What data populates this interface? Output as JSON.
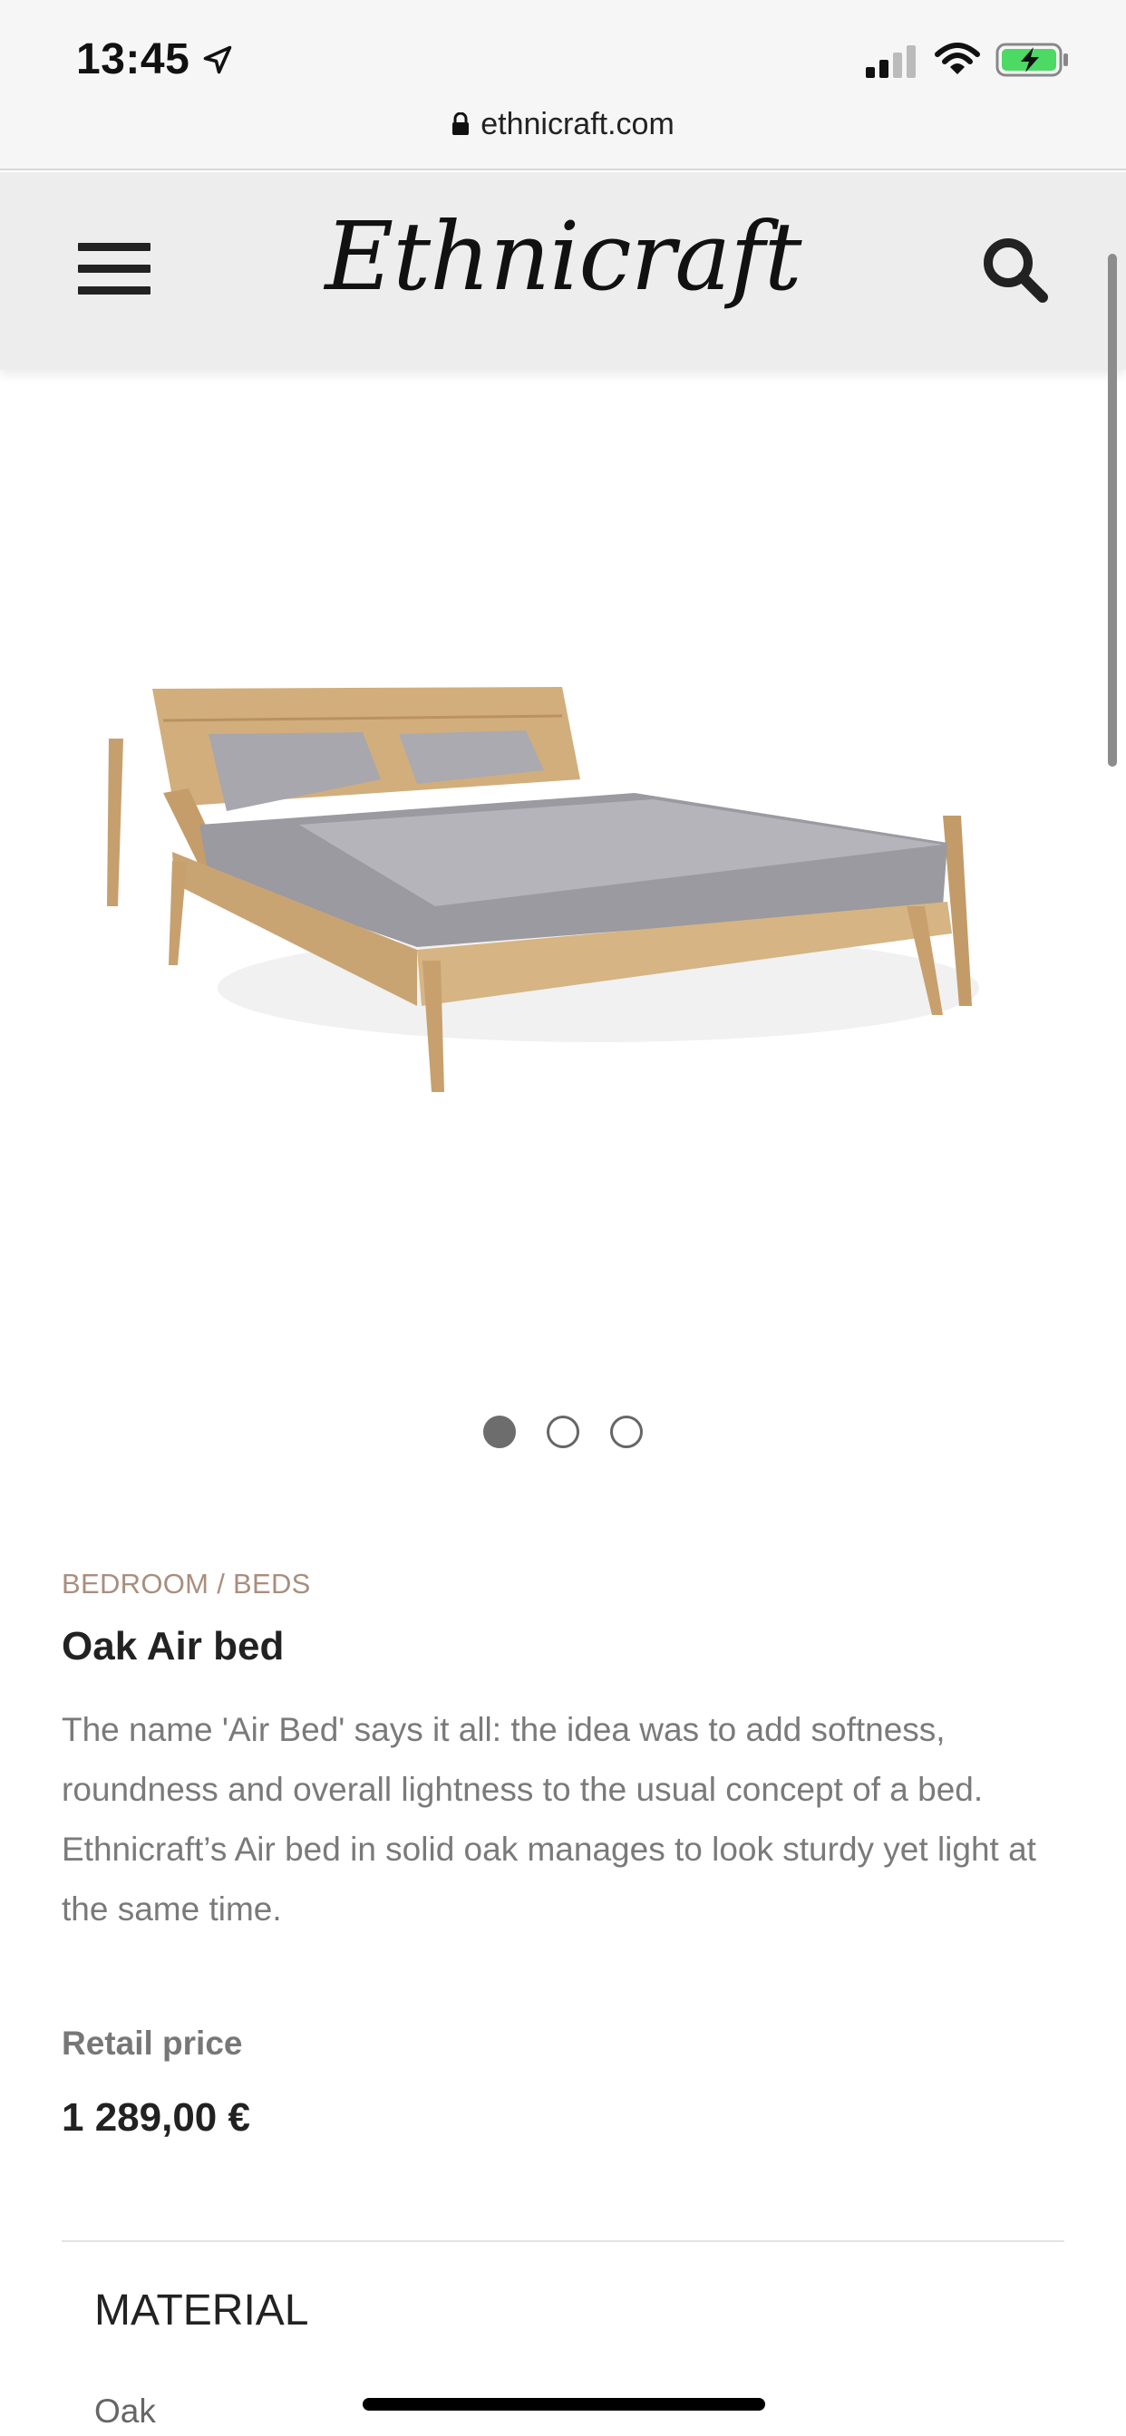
{
  "status_bar": {
    "time": "13:45",
    "url": "ethnicraft.com"
  },
  "header": {
    "logo_text": "Ethnicraft",
    "menu_icon": "hamburger-menu-icon",
    "search_icon": "search-icon"
  },
  "carousel": {
    "dot_count": 3,
    "active_index": 0
  },
  "product": {
    "breadcrumb": "BEDROOM / BEDS",
    "title": "Oak Air bed",
    "description": "The name 'Air Bed' says it all: the idea was to add softness, roundness and overall lightness to the usual concept of a bed. Ethnicraft’s Air bed in solid oak manages to look sturdy yet light at the same time.",
    "price_label": "Retail price",
    "price": "1 289,00 €"
  },
  "material": {
    "heading": "MATERIAL",
    "value": "Oak"
  },
  "colors": {
    "breadcrumb": "#a98e7e",
    "battery_fill": "#4cd964"
  }
}
